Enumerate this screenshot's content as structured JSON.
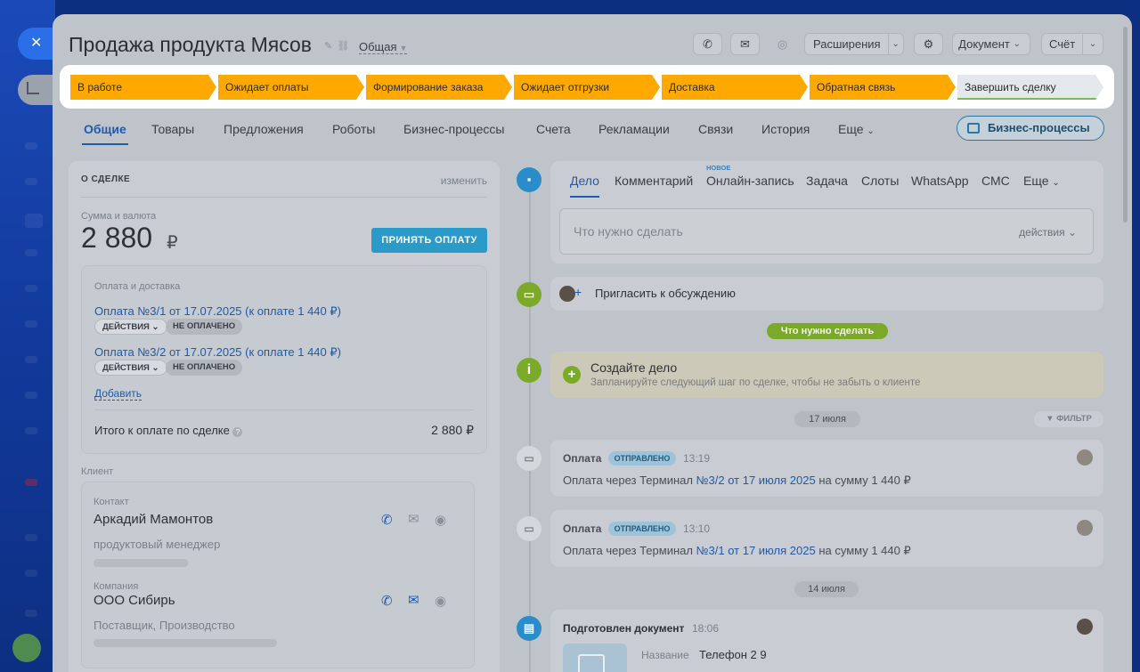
{
  "window": {
    "close_icon": "close-icon",
    "minimize_icon": "minimize-icon",
    "print_icon": "printer-icon"
  },
  "header": {
    "title": "Продажа продукта Мясов",
    "category": "Общая",
    "extensions_label": "Расширения",
    "document_label": "Документ",
    "invoice_label": "Счёт"
  },
  "stages": [
    {
      "label": "В работе",
      "color": "#ffa800"
    },
    {
      "label": "Ожидает оплаты",
      "color": "#ffa800"
    },
    {
      "label": "Формирование заказа",
      "color": "#ffa800"
    },
    {
      "label": "Ожидает отгрузки",
      "color": "#ffa800"
    },
    {
      "label": "Доставка",
      "color": "#ffa800"
    },
    {
      "label": "Обратная связь",
      "color": "#ffa800"
    },
    {
      "label": "Завершить сделку",
      "color": "#e4e7eb"
    }
  ],
  "tabs": [
    "Общие",
    "Товары",
    "Предложения",
    "Роботы",
    "Бизнес-процессы",
    "Счета",
    "Рекламации",
    "Связи",
    "История",
    "Еще"
  ],
  "bp_button": "Бизнес-процессы",
  "deal": {
    "header": "О СДЕЛКЕ",
    "edit": "изменить",
    "amount_label": "Сумма и валюта",
    "amount": "2 880",
    "currency": "₽",
    "pay_button": "ПРИНЯТЬ ОПЛАТУ",
    "payment_section": "Оплата и доставка",
    "payments": [
      {
        "title": "Оплата №3/1 от 17.07.2025 (к оплате 1 440 ₽)",
        "actions": "ДЕЙСТВИЯ",
        "status": "НЕ ОПЛАЧЕНО"
      },
      {
        "title": "Оплата №3/2 от 17.07.2025 (к оплате 1 440 ₽)",
        "actions": "ДЕЙСТВИЯ",
        "status": "НЕ ОПЛАЧЕНО"
      }
    ],
    "add": "Добавить",
    "total_label": "Итого к оплате по сделке",
    "total_value": "2 880 ₽"
  },
  "client": {
    "section": "Клиент",
    "contact_label": "Контакт",
    "contact_name": "Аркадий Мамонтов",
    "contact_role": "продуктовый менеджер",
    "company_label": "Компания",
    "company_name": "ООО Сибирь",
    "company_role": "Поставщик, Производство"
  },
  "activity": {
    "tabs": [
      "Дело",
      "Комментарий",
      "Онлайн-запись",
      "Задача",
      "Слоты",
      "WhatsApp",
      "СМС",
      "Еще"
    ],
    "new_badge": "НОВОЕ",
    "placeholder": "Что нужно сделать",
    "actions": "действия"
  },
  "timeline": {
    "invite": "Пригласить к обсуждению",
    "todo_pill": "Что нужно сделать",
    "create_title": "Создайте дело",
    "create_hint": "Запланируйте следующий шаг по сделке, чтобы не забыть о клиенте",
    "date1": "17 июля",
    "filter": "ФИЛЬТР",
    "events": [
      {
        "title": "Оплата",
        "status": "ОТПРАВЛЕНО",
        "time": "13:19",
        "prefix": "Оплата через Терминал",
        "link": "№3/2 от 17 июля 2025",
        "suffix": "на сумму 1 440 ₽"
      },
      {
        "title": "Оплата",
        "status": "ОТПРАВЛЕНО",
        "time": "13:10",
        "prefix": "Оплата через Терминал",
        "link": "№3/1 от 17 июля 2025",
        "suffix": "на сумму 1 440 ₽"
      }
    ],
    "date2": "14 июля",
    "doc_title": "Подготовлен документ",
    "doc_time": "18:06",
    "doc_name_label": "Название",
    "doc_name": "Телефон 2 9"
  }
}
